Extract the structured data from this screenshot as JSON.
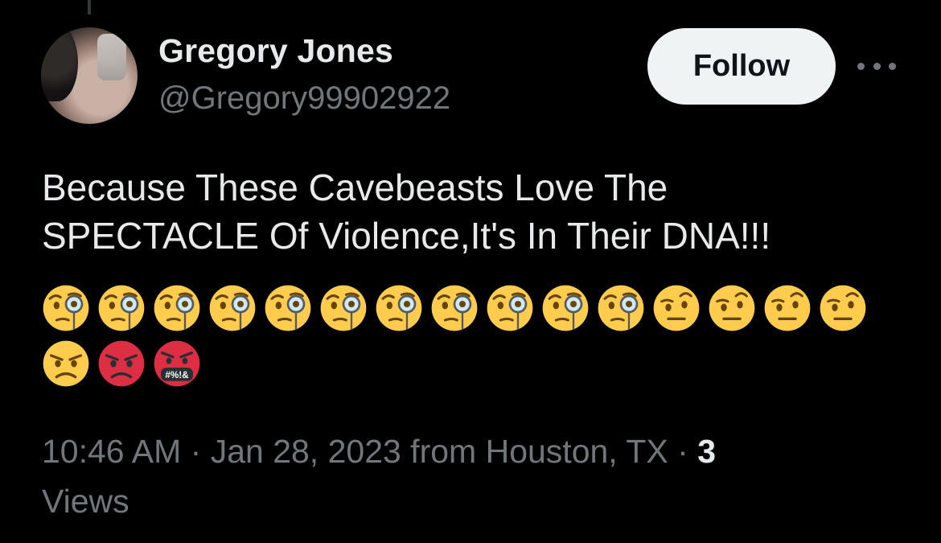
{
  "user": {
    "display_name": "Gregory Jones",
    "handle": "@Gregory99902922"
  },
  "follow_label": "Follow",
  "tweet": {
    "text_line1": "Because These Cavebeasts Love The",
    "text_line2": "SPECTACLE Of Violence,It's In Their DNA!!!",
    "emoji_row1": [
      "face-with-monocle",
      "face-with-monocle",
      "face-with-monocle",
      "face-with-monocle",
      "face-with-monocle",
      "face-with-monocle",
      "face-with-monocle",
      "face-with-monocle",
      "face-with-monocle",
      "face-with-monocle",
      "face-with-monocle",
      "face-with-raised-eyebrow",
      "face-with-raised-eyebrow",
      "face-with-raised-eyebrow",
      "face-with-raised-eyebrow"
    ],
    "emoji_row2": [
      "angry-face",
      "pouting-face",
      "face-with-symbols-on-mouth"
    ],
    "symbols_text": "#%!&"
  },
  "meta": {
    "time": "10:46 AM",
    "separator": "·",
    "date": "Jan 28, 2023",
    "source": "from Houston, TX",
    "views_count": "3",
    "views_label": "Views"
  },
  "colors": {
    "background": "#000000",
    "text": "#e7e9ea",
    "secondary": "#71767b",
    "follow_bg": "#eff3f4",
    "emoji_yellow": "#ffcc4d",
    "emoji_red": "#dd2e44"
  },
  "icons": {
    "more": "more-horizontal-icon"
  }
}
